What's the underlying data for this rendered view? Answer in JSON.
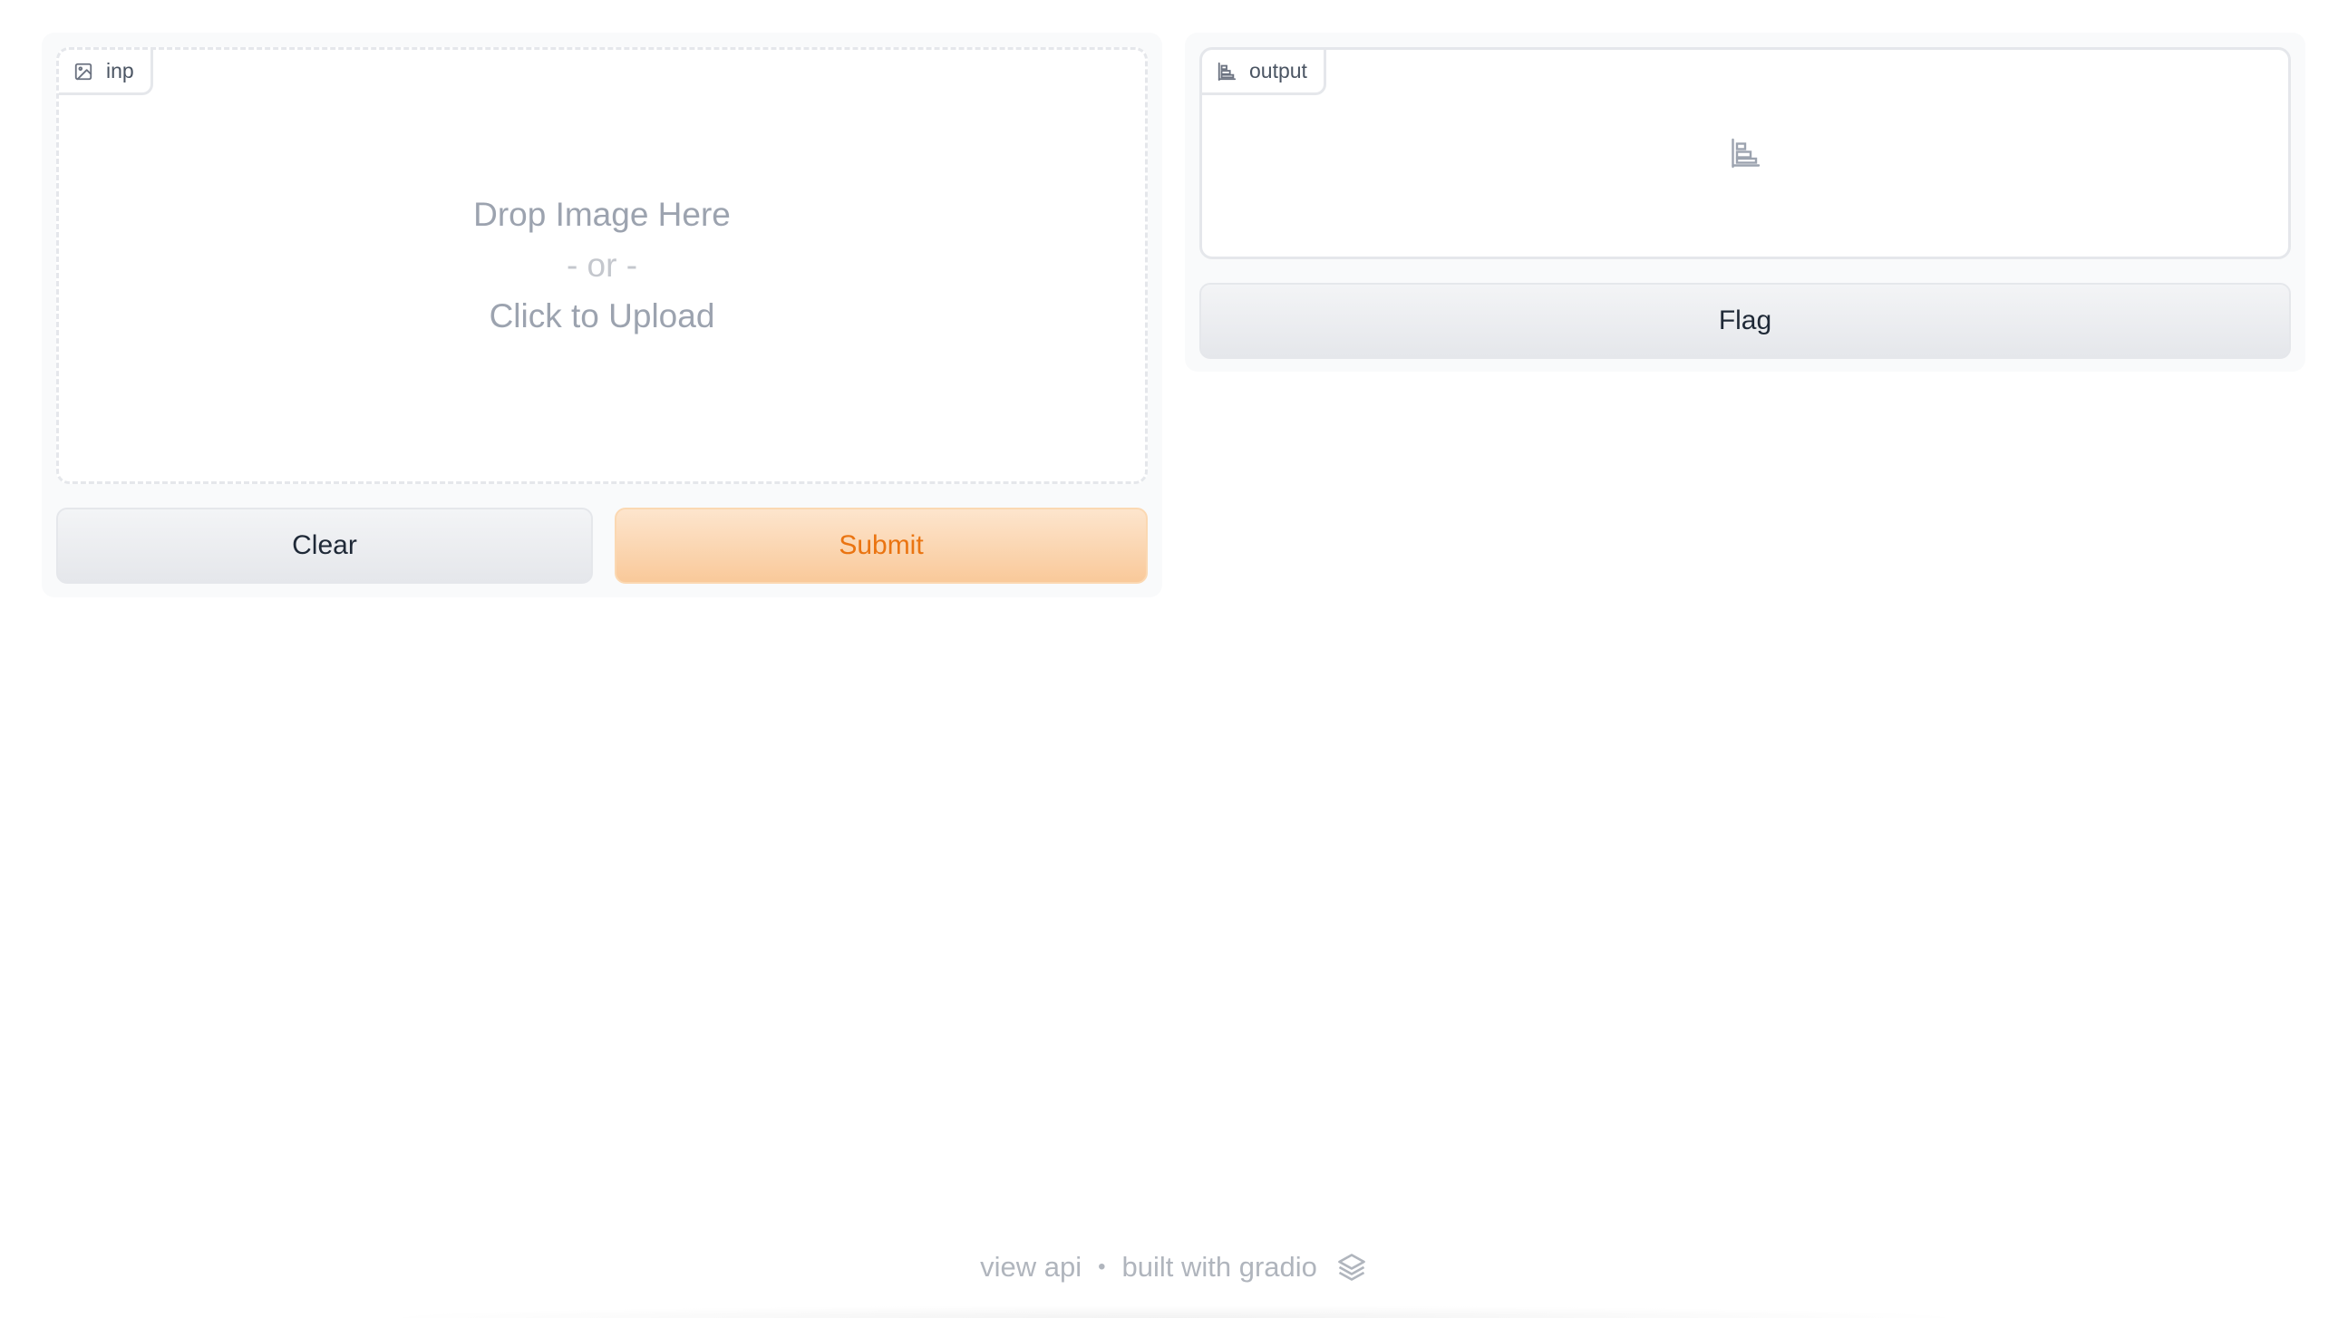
{
  "input_block": {
    "label": "inp",
    "icon": "image-icon",
    "drop_text": "Drop Image Here",
    "or_text": "- or -",
    "upload_text": "Click to Upload"
  },
  "output_block": {
    "label": "output",
    "icon": "bar-chart-icon"
  },
  "buttons": {
    "clear_label": "Clear",
    "submit_label": "Submit",
    "flag_label": "Flag"
  },
  "footer": {
    "view_api": "view api",
    "separator": "•",
    "built_with": "built with gradio",
    "logo_icon": "gradio-logo-icon"
  },
  "colors": {
    "accent_text": "#ea7411",
    "accent_bg": "#f9c99a",
    "muted_text": "#9ca3af"
  }
}
